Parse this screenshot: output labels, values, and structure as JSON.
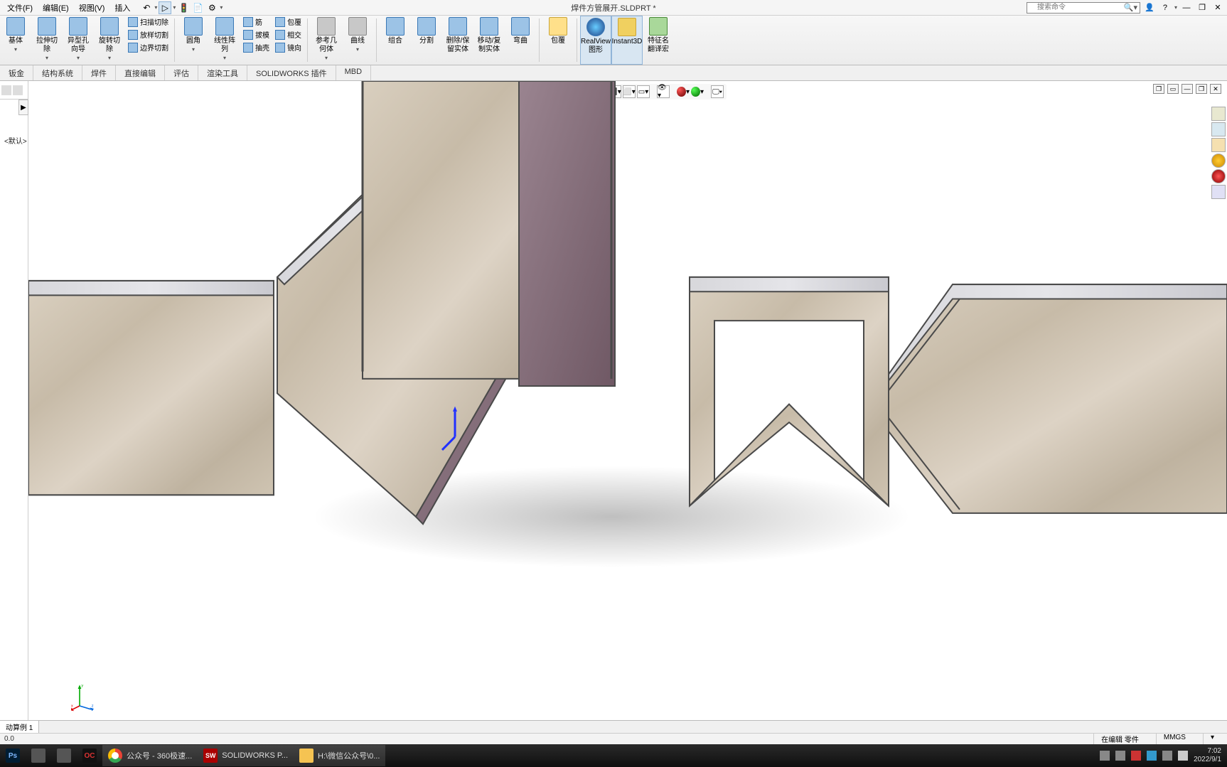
{
  "menubar": {
    "items": [
      "文件(F)",
      "编辑(E)",
      "视图(V)",
      "插入"
    ],
    "title": "焊件方管展开.SLDPRT *",
    "search_placeholder": "搜索命令",
    "help_glyph": "?",
    "min_glyph": "—",
    "restore_glyph": "❐",
    "close_glyph": "✕",
    "user_glyph": "👤"
  },
  "ribbon": {
    "groups": [
      {
        "big": [
          {
            "label": "基体"
          },
          {
            "label": "拉伸切\n除"
          },
          {
            "label": "异型孔\n向导"
          },
          {
            "label": "旋转切\n除"
          }
        ],
        "small": [
          [
            "扫描切除",
            "放样切割",
            "边界切割"
          ]
        ]
      },
      {
        "big": [
          {
            "label": "圆角"
          },
          {
            "label": "线性阵\n列"
          }
        ],
        "small": [
          [
            "筋",
            "拔模",
            "抽壳"
          ],
          [
            "包覆",
            "相交",
            "镜向"
          ]
        ]
      },
      {
        "big": [
          {
            "label": "参考几\n何体"
          },
          {
            "label": "曲线"
          }
        ]
      },
      {
        "big": [
          {
            "label": "组合"
          },
          {
            "label": "分割"
          },
          {
            "label": "删除/保\n留实体"
          },
          {
            "label": "移动/复\n制实体"
          },
          {
            "label": "弯曲"
          }
        ]
      },
      {
        "big": [
          {
            "label": "包覆"
          }
        ]
      },
      {
        "big": [
          {
            "label": "RealView\n图形",
            "toggled": true
          },
          {
            "label": "Instant3D",
            "toggled": true
          },
          {
            "label": "特征名\n翻译宏",
            "cls": "green"
          }
        ]
      }
    ]
  },
  "tabs": [
    "钣金",
    "结构系统",
    "焊件",
    "直接编辑",
    "评估",
    "渲染工具",
    "SOLIDWORKS 插件",
    "MBD"
  ],
  "tree": {
    "config": "<默认>"
  },
  "viewhud_icons": [
    "◫",
    "◧",
    "◈",
    "",
    "◐",
    "◑",
    "⬚",
    "⬛",
    "⬜",
    "▭",
    "",
    "👁",
    "",
    "●",
    "●",
    "",
    "▭"
  ],
  "docwin": [
    "❐",
    "▭",
    "—",
    "❐",
    "✕"
  ],
  "taskpane_icons": [
    "home",
    "res",
    "folder",
    "globe",
    "appear",
    "list"
  ],
  "motionbar": {
    "label": "动算例 1"
  },
  "statusbar": {
    "left": "0.0",
    "editing": "在编辑 零件",
    "units": "MMGS",
    "extra": "▾"
  },
  "taskbar": {
    "apps": [
      {
        "icon": "ps",
        "label": ""
      },
      {
        "icon": "generic",
        "label": ""
      },
      {
        "icon": "generic",
        "label": ""
      },
      {
        "icon": "oc",
        "label": ""
      },
      {
        "icon": "chrome",
        "label": "公众号 - 360极速..."
      },
      {
        "icon": "sw",
        "label": "SOLIDWORKS P..."
      },
      {
        "icon": "folder",
        "label": "H:\\微信公众号\\0..."
      }
    ],
    "time": "7:02",
    "date": "2022/9/1"
  },
  "triad_labels": {
    "x": "x",
    "y": "y",
    "z": "z"
  }
}
